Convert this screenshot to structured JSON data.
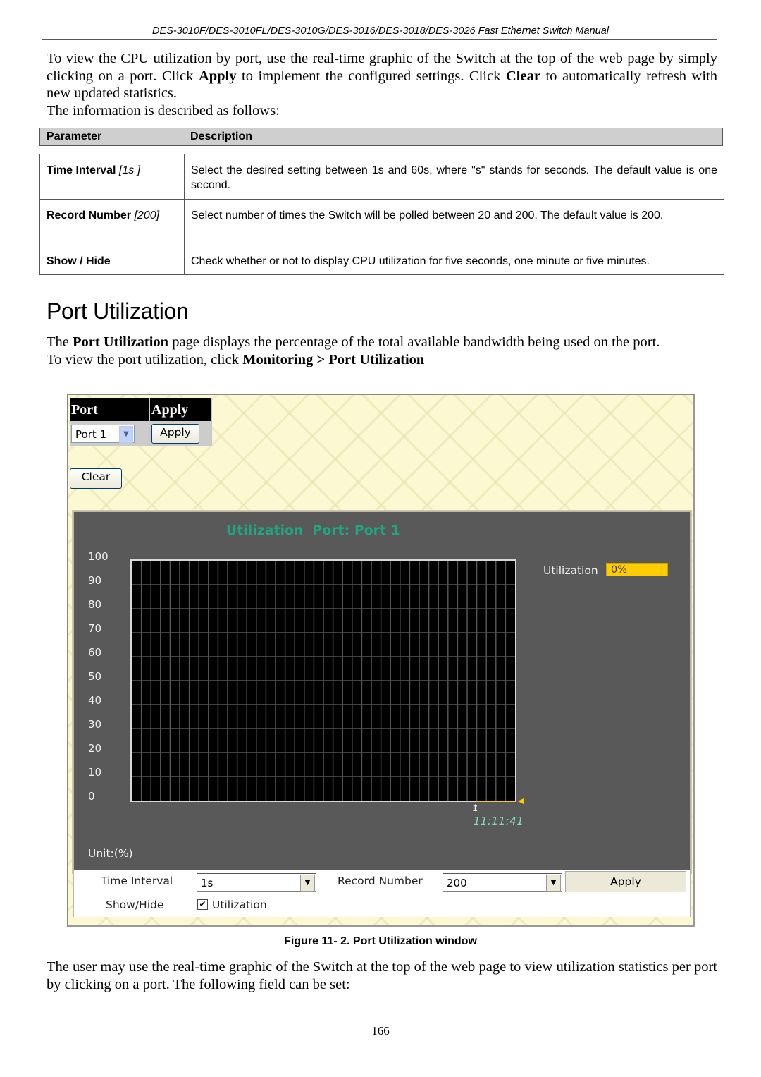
{
  "header": {
    "title": "DES-3010F/DES-3010FL/DES-3010G/DES-3016/DES-3018/DES-3026 Fast Ethernet Switch Manual"
  },
  "intro": {
    "p1_a": "To view the CPU utilization by port, use the real-time graphic of the Switch at the top of the web page by simply clicking on a port. Click ",
    "p1_b": "Apply",
    "p1_c": " to implement the configured settings. Click ",
    "p1_d": "Clear",
    "p1_e": " to automatically refresh with new updated statistics.",
    "p2": "The information is described as follows:"
  },
  "param_table": {
    "headers": [
      "Parameter",
      "Description"
    ],
    "rows": [
      {
        "name": "Time Interval",
        "default": "[1s ]",
        "description": "Select the desired setting between 1s and 60s, where \"s\" stands for seconds. The default value is one second."
      },
      {
        "name": "Record Number",
        "default": "[200]",
        "description": "Select number of times the Switch will be polled between 20 and 200. The default value is 200."
      },
      {
        "name": "Show / Hide",
        "default": "",
        "description": "Check whether or not to display CPU utilization for five seconds, one minute or five minutes."
      }
    ]
  },
  "section": {
    "title": "Port Utilization",
    "p1_a": "The ",
    "p1_b": "Port Utilization",
    "p1_c": " page displays the percentage of the total available bandwidth being used on the port.",
    "p2_a": "To view the port utilization, click ",
    "p2_b": "Monitoring",
    "p2_c": " > ",
    "p2_d": "Port Utilization"
  },
  "figure": {
    "port_header": "Port",
    "apply_header": "Apply",
    "port_select": "Port 1",
    "apply_button": "Apply",
    "clear_button": "Clear",
    "chart_title": "Utilization  Port: Port 1",
    "utilization_label": "Utilization",
    "utilization_value": "0%",
    "timestamp": "11:11:41",
    "unit_label": "Unit:(%)",
    "time_interval_label": "Time Interval",
    "time_interval_value": "1s",
    "record_number_label": "Record Number",
    "record_number_value": "200",
    "apply_button_2": "Apply",
    "show_hide_label": "Show/Hide",
    "show_hide_checkbox_label": "Utilization",
    "show_hide_checked": true,
    "colors": {
      "title": "#1fa783",
      "line": "#ffcc00",
      "panel": "#595959",
      "grid_bg": "#000000"
    }
  },
  "chart_data": {
    "type": "line",
    "title": "Utilization  Port: Port 1",
    "xlabel": "",
    "ylabel": "Unit:(%)",
    "yticks": [
      "100",
      "90",
      "80",
      "70",
      "60",
      "50",
      "40",
      "30",
      "20",
      "10",
      "0"
    ],
    "ylim": [
      0,
      100
    ],
    "x": [
      "11:11:41"
    ],
    "series": [
      {
        "name": "Utilization",
        "values": [
          0
        ]
      }
    ],
    "grid": true,
    "legend": "right"
  },
  "caption": "Figure 11- 2. Port Utilization window",
  "outro": "The user may use the real-time graphic of the Switch at the top of the web page to view utilization statistics per port by clicking on a port. The following field can be set:",
  "page_number": "166"
}
